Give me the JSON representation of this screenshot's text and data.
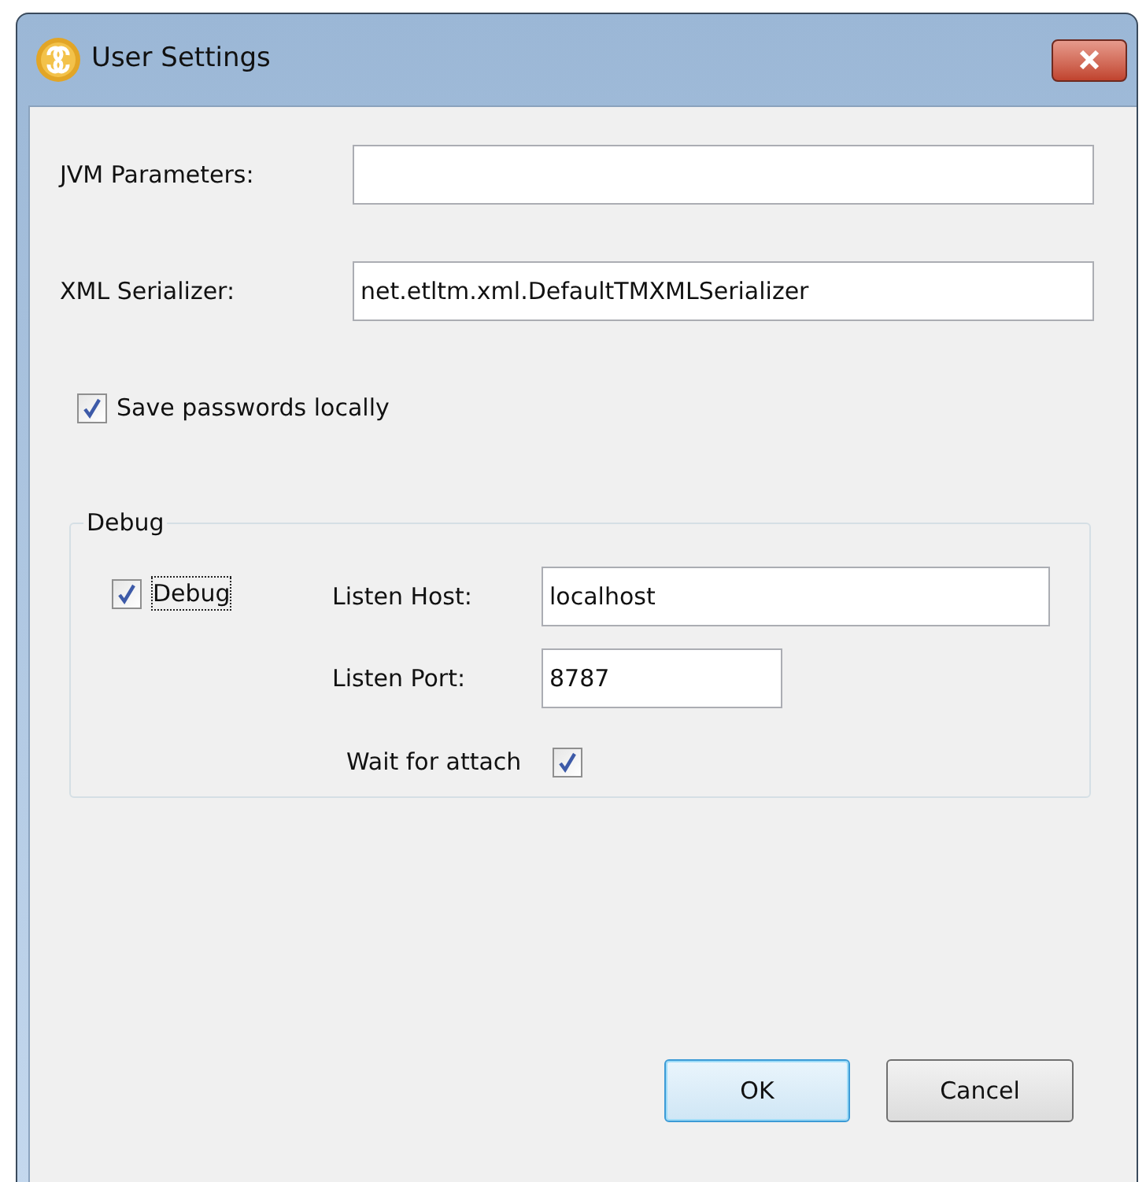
{
  "window": {
    "title": "User Settings"
  },
  "fields": [
    {
      "label": "JVM Parameters:"
    },
    {
      "label": "XML Serializer:",
      "value": "net.etltm.xml.DefaultTMXMLSerializer"
    }
  ],
  "save_passwords": {
    "label": "Save passwords locally",
    "checked": true
  },
  "debug_group": {
    "title": "Debug",
    "debug": {
      "label": "Debug",
      "checked": true,
      "focused": true
    },
    "listen_host": {
      "label": "Listen Host:",
      "value": "localhost"
    },
    "listen_port": {
      "label": "Listen Port:",
      "value": "8787"
    },
    "wait_for_attach": {
      "label": "Wait for attach",
      "checked": true
    }
  },
  "buttons": [
    {
      "label": "OK",
      "default": true
    },
    {
      "label": "Cancel",
      "default": false
    }
  ]
}
